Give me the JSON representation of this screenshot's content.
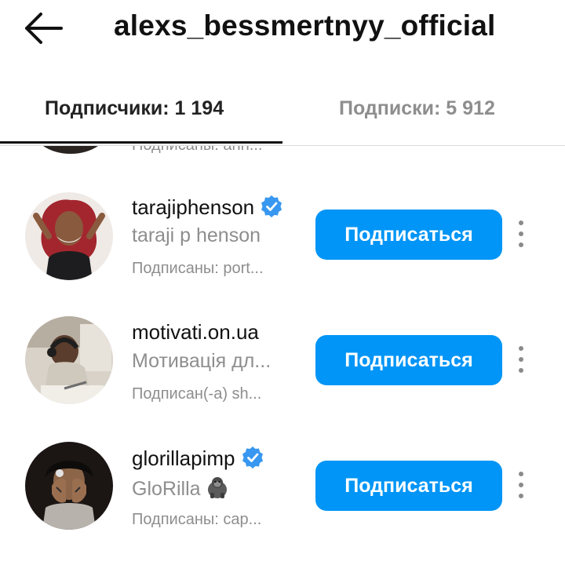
{
  "header": {
    "title": "alexs_bessmertnyy_official",
    "back_icon": "arrow-left-icon"
  },
  "tabs": {
    "followers_label": "Подписчики: 1 194",
    "following_label": "Подписки: 5 912",
    "active": "followers"
  },
  "list": {
    "partial_row_subtext": "Подписаны: ann...",
    "items": [
      {
        "username": "tarajiphenson",
        "verified": true,
        "full_name": "taraji p henson",
        "subtext": "Подписаны: port...",
        "button_label": "Подписаться"
      },
      {
        "username": "motivati.on.ua",
        "verified": false,
        "full_name": "Мотивація дл...",
        "subtext": "Подписан(-а) sh...",
        "button_label": "Подписаться"
      },
      {
        "username": "glorillapimp",
        "verified": true,
        "full_name": "GloRilla",
        "full_name_emoji": "gorilla-emoji",
        "subtext": "Подписаны: cap...",
        "button_label": "Подписаться"
      }
    ]
  },
  "colors": {
    "accent": "#0095f6",
    "verified_badge": "#3897f0",
    "secondary_text": "#8e8e8e"
  }
}
